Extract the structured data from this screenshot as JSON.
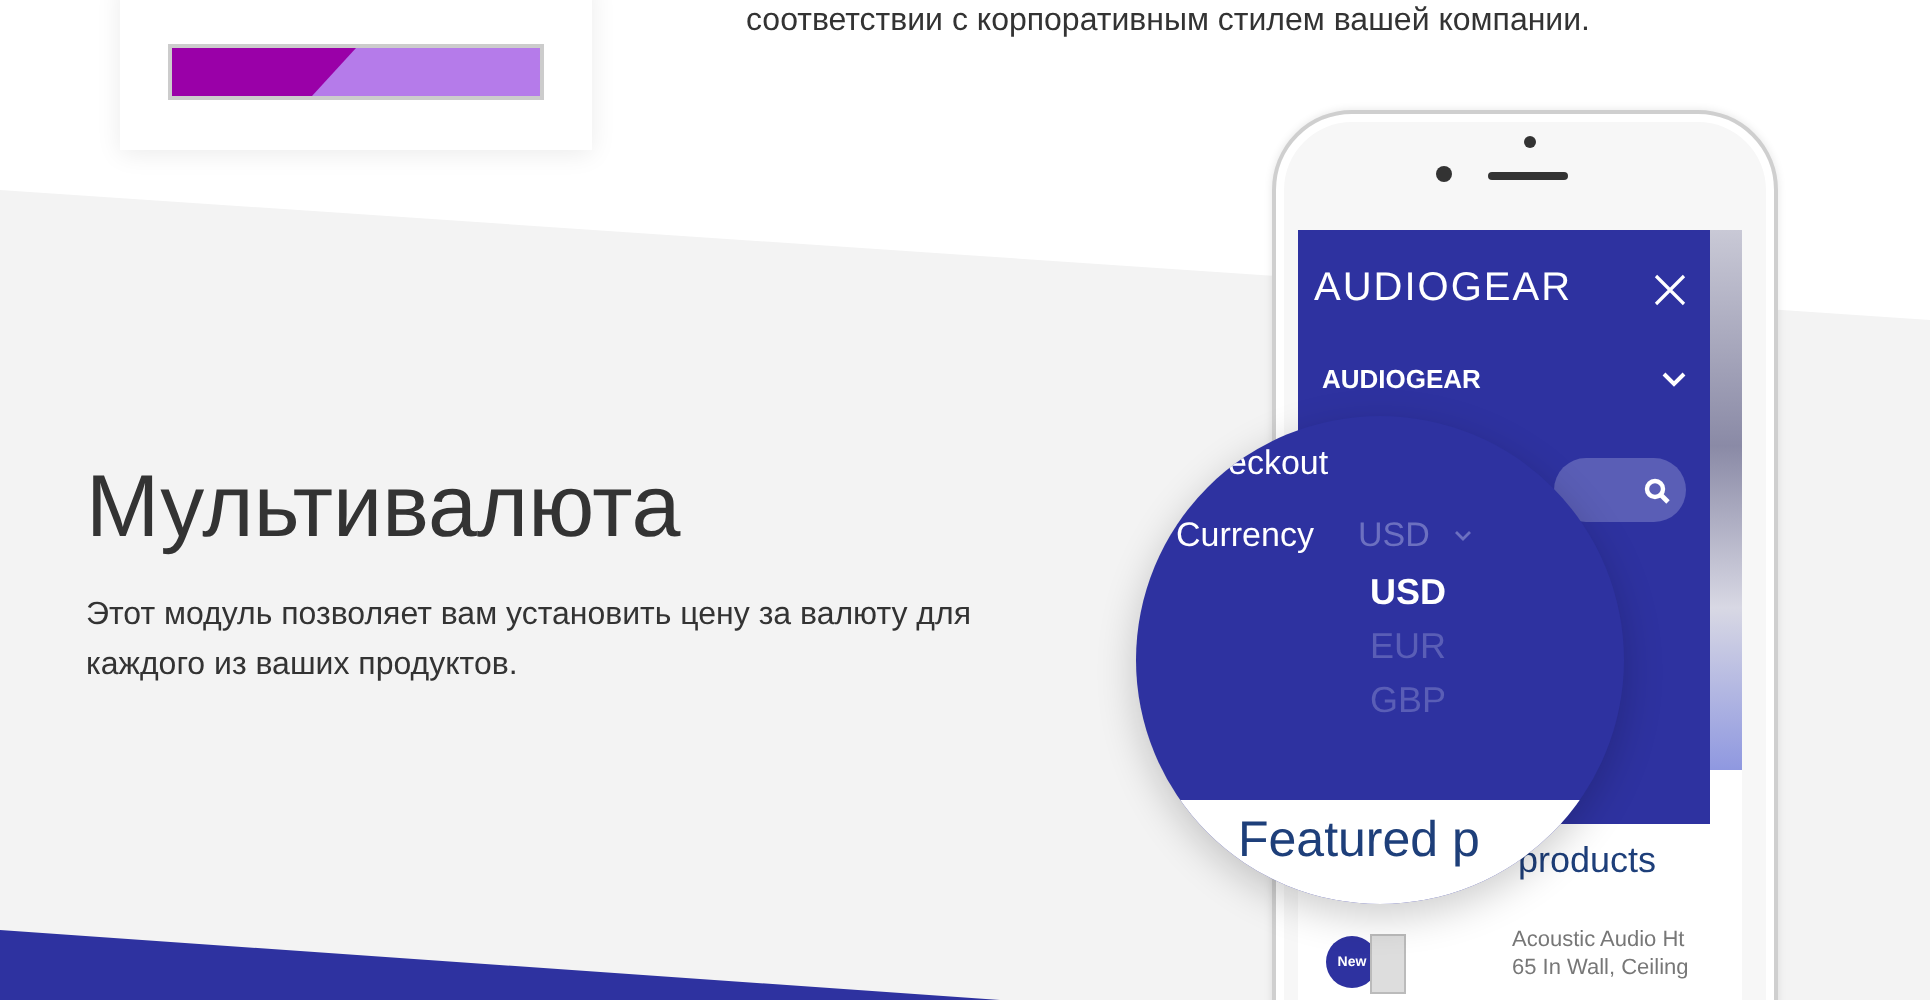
{
  "top_text": "соответствии с корпоративным стилем вашей компании.",
  "color_card": {
    "level": 0.5
  },
  "section": {
    "title": "Мультивалюта",
    "description": "Этот модуль позволяет вам установить цену за валюту для каждого из ваших продуктов."
  },
  "phone": {
    "logo": "AUDIOGEAR",
    "menu_dropdown": "AUDIOGEAR",
    "featured_heading": "products",
    "product": {
      "badge": "New",
      "name_lines": [
        "Acoustic Audio Ht",
        "65 In Wall, Ceiling"
      ]
    }
  },
  "magnifier": {
    "menu_item": "eckout",
    "currency_label": "Currency",
    "currency_value": "USD",
    "options": [
      {
        "label": "USD",
        "selected": true
      },
      {
        "label": "EUR",
        "selected": false
      },
      {
        "label": "GBP",
        "selected": false
      }
    ],
    "featured_heading": "Featured p"
  }
}
